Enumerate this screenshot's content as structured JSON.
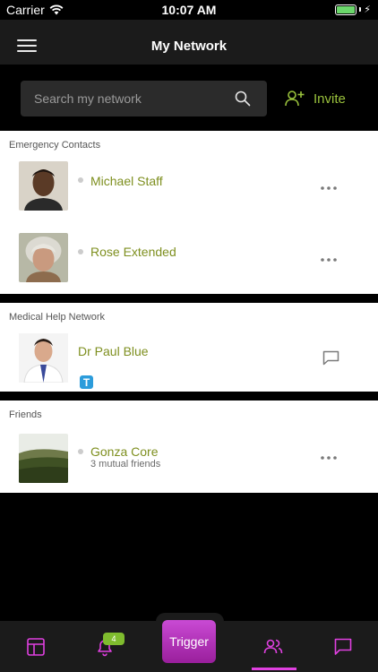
{
  "status_bar": {
    "carrier": "Carrier",
    "time": "10:07 AM",
    "battery_level": 1.0
  },
  "header": {
    "title": "My Network"
  },
  "search": {
    "placeholder": "Search my network",
    "invite_label": "Invite"
  },
  "sections": {
    "emergency": {
      "title": "Emergency Contacts",
      "contacts": [
        {
          "name": "Michael Staff",
          "status": "offline"
        },
        {
          "name": "Rose Extended",
          "status": "offline"
        }
      ]
    },
    "medical": {
      "title": "Medical Help Network",
      "contacts": [
        {
          "name": "Dr Paul Blue",
          "badge": "T"
        }
      ]
    },
    "friends": {
      "title": "Friends",
      "contacts": [
        {
          "name": "Gonza Core",
          "subtitle": "3 mutual friends",
          "status": "offline"
        }
      ]
    }
  },
  "tab_bar": {
    "notification_count": "4",
    "trigger_label": "Trigger",
    "active_tab": "network"
  },
  "colors": {
    "accent_green": "#7e8f1f",
    "invite_green": "#9ac23c",
    "accent_magenta": "#e040e0",
    "trigger_gradient_top": "#c94ad4",
    "trigger_gradient_bottom": "#9a1f9c",
    "badge_blue": "#2c9cdb"
  }
}
